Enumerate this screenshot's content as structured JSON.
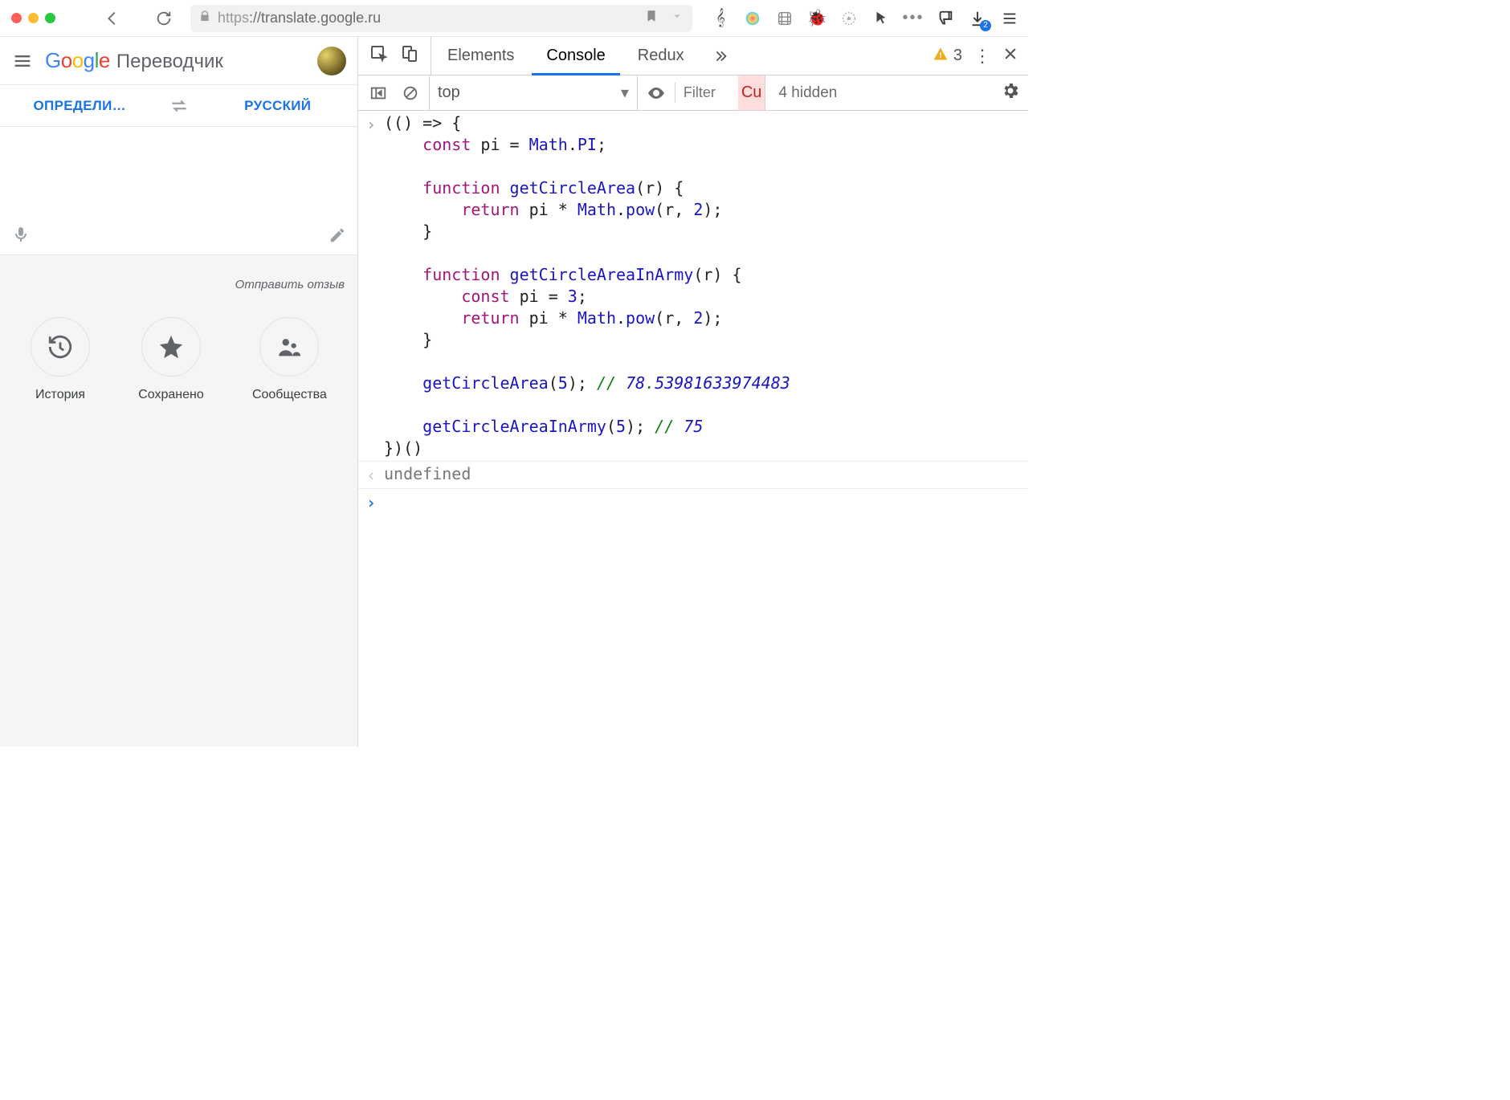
{
  "browser": {
    "url_scheme": "https",
    "url_host": "://translate.google.ru",
    "downloads_badge": "2"
  },
  "translate": {
    "product": "Переводчик",
    "source_lang": "ОПРЕДЕЛИ…",
    "target_lang": "РУССКИЙ",
    "feedback": "Отправить отзыв",
    "circles": {
      "history": "История",
      "saved": "Сохранено",
      "community": "Сообщества"
    }
  },
  "devtools": {
    "tabs": {
      "elements": "Elements",
      "console": "Console",
      "redux": "Redux"
    },
    "warnings": "3",
    "context": "top",
    "filter_placeholder": "Filter",
    "custom_badge": "Cu",
    "hidden": "4 hidden",
    "console": {
      "input_lines": [
        "(() => {",
        "    const pi = Math.PI;",
        "",
        "    function getCircleArea(r) {",
        "        return pi * Math.pow(r, 2);",
        "    }",
        "",
        "    function getCircleAreaInArmy(r) {",
        "        const pi = 3;",
        "        return pi * Math.pow(r, 2);",
        "    }",
        "",
        "    getCircleArea(5); // 78.53981633974483",
        "",
        "    getCircleAreaInArmy(5); // 75",
        "})()"
      ],
      "output": "undefined"
    }
  }
}
